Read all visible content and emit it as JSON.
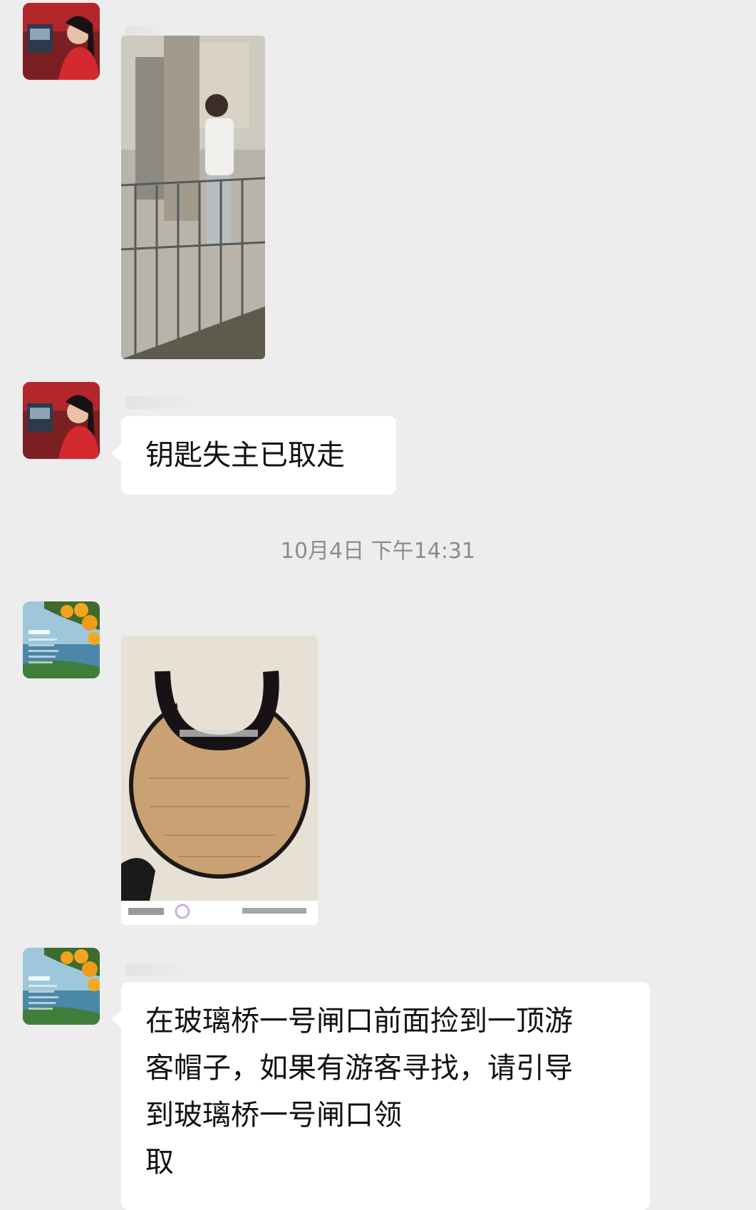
{
  "messages": [
    {
      "type": "image",
      "subject": "man-at-railing-photo"
    },
    {
      "type": "text",
      "lines": [
        "钥匙失主已取走"
      ]
    },
    {
      "type": "image",
      "subject": "sun-visor-hat-photo",
      "caption_blurred": true
    },
    {
      "type": "text",
      "lines": [
        "在玻璃桥一号闸口前面捡到一顶游",
        "客帽子，如果有游客寻找，请引导",
        "到玻璃桥一号闸口领",
        "取"
      ]
    }
  ],
  "timestamp": "10月4日 下午14:31",
  "colors": {
    "background": "#ededed",
    "bubble": "#ffffff",
    "timestamp_text": "#8c8c8c"
  },
  "icons": {
    "avatar_1": "woman-red-avatar",
    "avatar_2": "oranges-landscape-avatar"
  }
}
